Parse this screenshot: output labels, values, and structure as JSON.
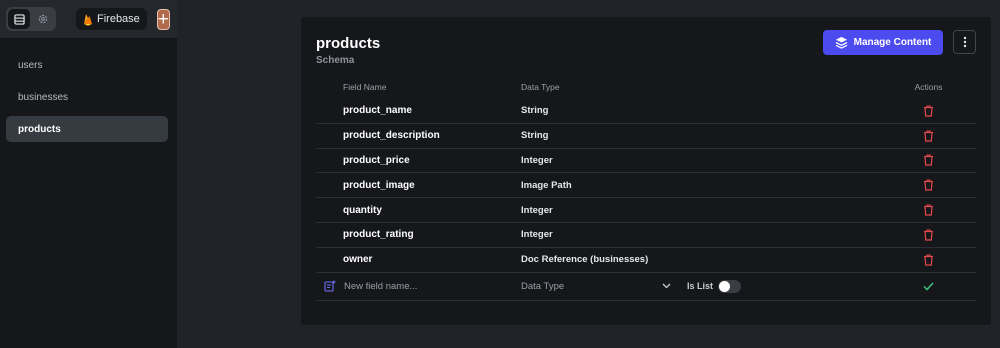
{
  "header": {
    "project_name": "Firebase",
    "add_label": "+"
  },
  "sidebar": {
    "items": [
      {
        "label": "users"
      },
      {
        "label": "businesses"
      },
      {
        "label": "products"
      }
    ]
  },
  "collection": {
    "title": "products",
    "subtitle": "Schema",
    "manage_label": "Manage Content",
    "columns": {
      "field": "Field Name",
      "type": "Data Type",
      "actions": "Actions"
    },
    "fields": [
      {
        "name": "product_name",
        "type": "String"
      },
      {
        "name": "product_description",
        "type": "String"
      },
      {
        "name": "product_price",
        "type": "Integer"
      },
      {
        "name": "product_image",
        "type": "Image Path"
      },
      {
        "name": "quantity",
        "type": "Integer"
      },
      {
        "name": "product_rating",
        "type": "Integer"
      },
      {
        "name": "owner",
        "type": "Doc Reference (businesses)"
      }
    ],
    "new_field": {
      "placeholder": "New field name...",
      "type_placeholder": "Data Type",
      "is_list_label": "Is List"
    }
  },
  "colors": {
    "accent": "#4b4bf0",
    "delete": "#e5484d",
    "confirm": "#3ec27a",
    "add_button": "#b06a4b"
  },
  "icons": [
    "table-icon",
    "gear-icon",
    "firebase-icon",
    "layers-icon",
    "more-vertical-icon",
    "trash-icon",
    "new-field-icon",
    "chevron-down-icon",
    "check-icon"
  ]
}
